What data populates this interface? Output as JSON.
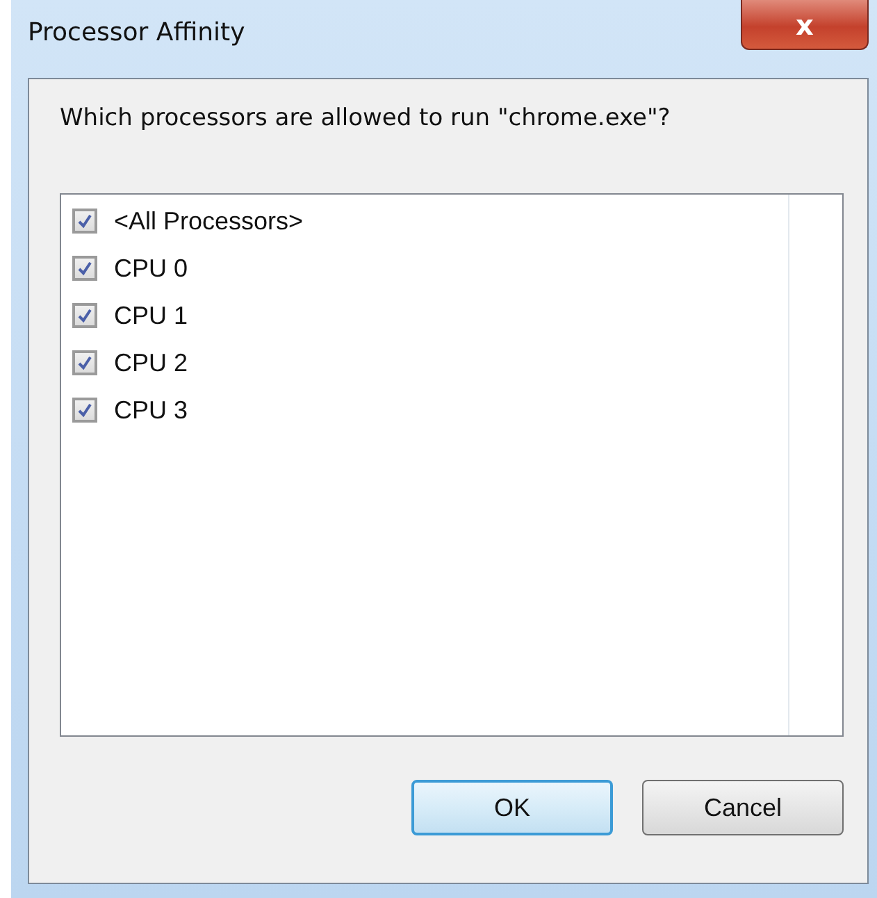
{
  "window": {
    "title": "Processor Affinity",
    "close": "x"
  },
  "question": "Which processors are allowed to run \"chrome.exe\"?",
  "processors": [
    {
      "label": "<All Processors>",
      "checked": true
    },
    {
      "label": "CPU 0",
      "checked": true
    },
    {
      "label": "CPU 1",
      "checked": true
    },
    {
      "label": "CPU 2",
      "checked": true
    },
    {
      "label": "CPU 3",
      "checked": true
    }
  ],
  "buttons": [
    {
      "label": "OK",
      "default": true
    },
    {
      "label": "Cancel",
      "default": false
    }
  ]
}
